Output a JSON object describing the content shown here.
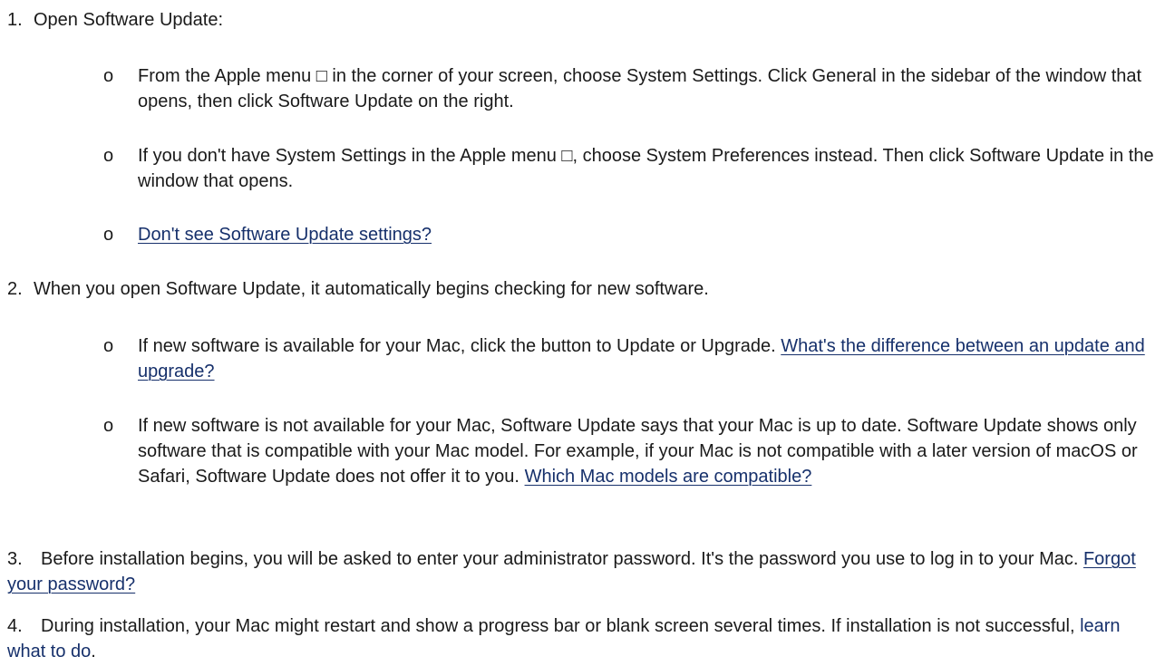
{
  "steps": [
    {
      "number": "1.",
      "text": "Open Software Update:",
      "subitems": [
        {
          "bullet": "o",
          "text": "From the Apple menu □ in the corner of your screen, choose System Settings. Click General in the sidebar of the window that opens, then click Software Update on the right."
        },
        {
          "bullet": "o",
          "text": "If you don't have System Settings in the Apple menu □, choose System Preferences instead. Then click Software Update in the window that opens."
        },
        {
          "bullet": "o",
          "link": "Don't see Software Update settings?"
        }
      ]
    },
    {
      "number": "2.",
      "text": "When you open Software Update, it automatically begins checking for new software.",
      "subitems": [
        {
          "bullet": "o",
          "text": "If new software is available for your Mac, click the button to Update or Upgrade.",
          "link": "What's the difference between an update and upgrade?"
        },
        {
          "bullet": "o",
          "text": "If new software is not available for your Mac, Software Update says that your Mac is up to date. Software Update shows only software that is compatible with your Mac model. For example, if your Mac is not compatible with a later version of macOS or Safari, Software Update does not offer it to you.",
          "link": "Which Mac models are compatible?"
        }
      ]
    },
    {
      "number": "3.",
      "text": "Before installation begins, you will be asked to enter your administrator password. It's the password you use to log in to your Mac.",
      "link": "Forgot your password?"
    },
    {
      "number": "4.",
      "text": "During installation, your Mac might restart and show a progress bar or blank screen several times. If installation is not successful,",
      "link": "learn what to do",
      "suffix": "."
    }
  ],
  "colors": {
    "text": "#1a1a1a",
    "link": "#16306b",
    "background": "#ffffff"
  }
}
